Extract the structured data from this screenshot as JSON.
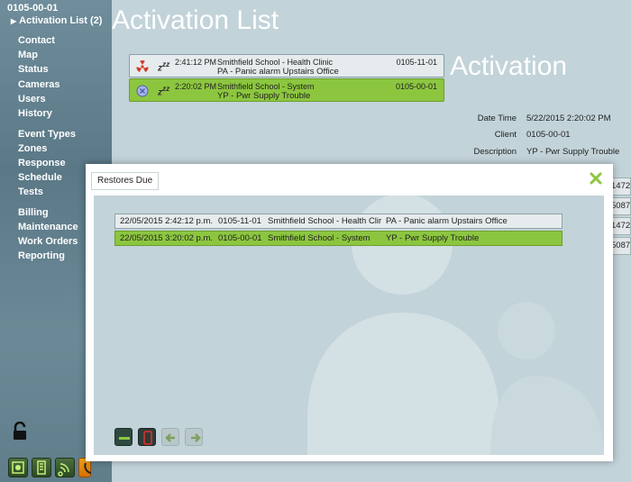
{
  "sidebar": {
    "client_id": "0105-00-01",
    "active": "Activation List (2)",
    "items": [
      "Contact",
      "Map",
      "Status",
      "Cameras",
      "Users",
      "History",
      "Event Types",
      "Zones",
      "Response",
      "Schedule",
      "Tests",
      "Billing",
      "Maintenance",
      "Work Orders",
      "Reporting"
    ]
  },
  "main": {
    "title": "Activation List",
    "detail_title": "Activation",
    "activations": [
      {
        "icon": "radiation-icon",
        "time": "2:41:12 PM",
        "site": "Smithfield School - Health Clinic",
        "event": "PA - Panic alarm Upstairs Office",
        "code": "0105-11-01"
      },
      {
        "icon": "x-circle-icon",
        "time": "2:20:02 PM",
        "site": "Smithfield School - System",
        "event": "YP - Pwr Supply Trouble",
        "code": "0105-00-01"
      }
    ],
    "details": [
      {
        "label": "Date Time",
        "value": "5/22/2015 2:20:02 PM"
      },
      {
        "label": "Client",
        "value": "0105-00-01"
      },
      {
        "label": "Description",
        "value": "YP - Pwr Supply Trouble"
      }
    ],
    "side_values": [
      "1472",
      "5087",
      "1472",
      "5087"
    ]
  },
  "modal": {
    "tab": "Restores Due",
    "rows": [
      {
        "datetime": "22/05/2015 2:42:12 p.m.",
        "code": "0105-11-01",
        "site": "Smithfield School - Health Clir",
        "event": "PA - Panic alarm Upstairs Office"
      },
      {
        "datetime": "22/05/2015 3:20:02 p.m.",
        "code": "0105-00-01",
        "site": "Smithfield School - System",
        "event": "YP - Pwr Supply Trouble"
      }
    ]
  },
  "colors": {
    "accent": "#8cc63f",
    "sidebar": "#5f7d8a",
    "panel": "#c2d3d9"
  }
}
